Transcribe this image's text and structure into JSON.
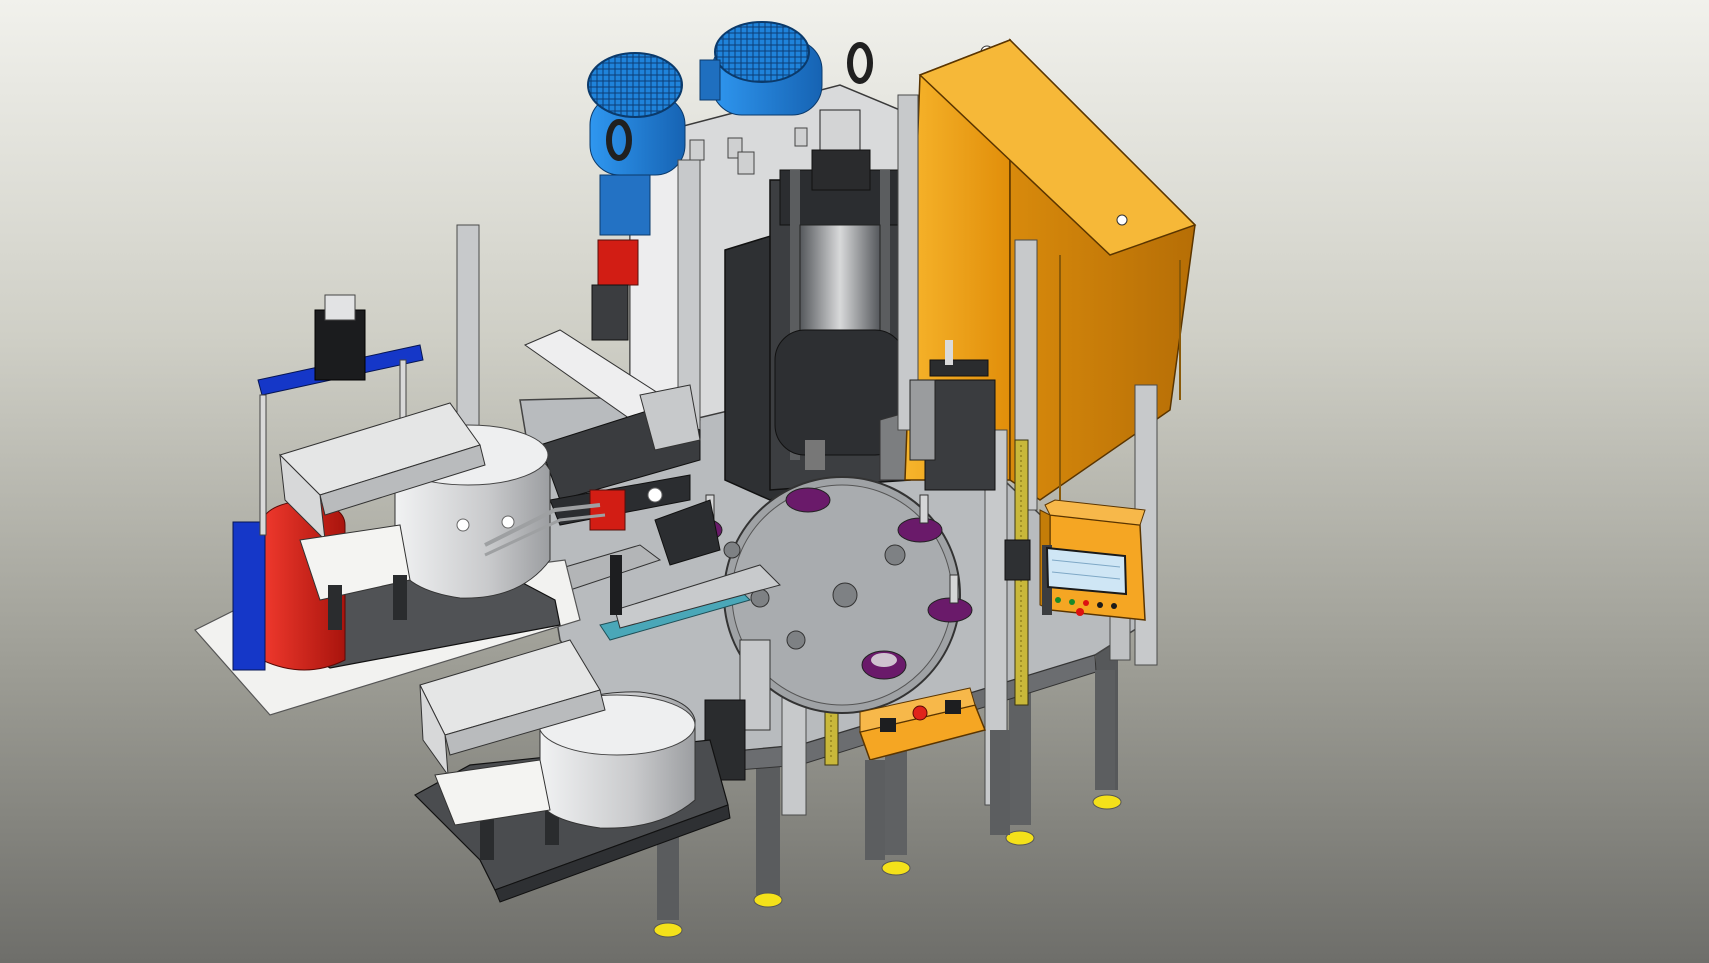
{
  "viewport": {
    "background_top": "#f1f1ec",
    "background_bottom": "#6e6e6a"
  },
  "palette": {
    "frame": "#5b5d5f",
    "table_top": "#b9bcbf",
    "cabinet": "#f3a316",
    "motor": "#1e7fd6",
    "guard": "#3b3d40",
    "feeder_bowl": "#d9dadb",
    "red_tank": "#e0231b",
    "blue_beam": "#1537c8",
    "foot": "#f4e11a",
    "light_curtain": "#c9b83a",
    "hmi_screen": "#cfe6f5"
  },
  "icons": [
    "assembly-machine-3d-model",
    "rotary-index-table",
    "electric-motor",
    "electrical-cabinet",
    "vibratory-feeder-bowl",
    "hmi-panel",
    "control-box",
    "leveling-foot"
  ]
}
